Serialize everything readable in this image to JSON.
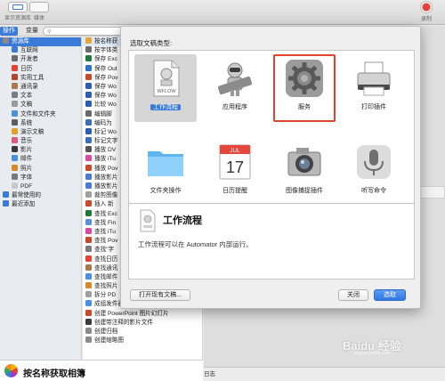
{
  "toolbar": {
    "library_label": "显示资源库",
    "media_label": "媒体",
    "record_label": "录制"
  },
  "library_bar": {
    "tab_actions": "操作",
    "tab_variables": "变量"
  },
  "library": {
    "items": [
      {
        "label": "资源库",
        "level": "root",
        "color": "#8a8a8a"
      },
      {
        "label": "互联网",
        "level": "lvl1",
        "color": "#3b7ad8"
      },
      {
        "label": "开发者",
        "level": "lvl1",
        "color": "#6c6c6c"
      },
      {
        "label": "日历",
        "level": "lvl1",
        "color": "#e94335"
      },
      {
        "label": "实用工具",
        "level": "lvl1",
        "color": "#b0472d"
      },
      {
        "label": "通讯录",
        "level": "lvl1",
        "color": "#a8794a"
      },
      {
        "label": "文本",
        "level": "lvl1",
        "color": "#7d7d7d"
      },
      {
        "label": "文稿",
        "level": "lvl1",
        "color": "#9a9a9a"
      },
      {
        "label": "文件和文件夹",
        "level": "lvl1",
        "color": "#4a90d9"
      },
      {
        "label": "系统",
        "level": "lvl1",
        "color": "#5d5d5d"
      },
      {
        "label": "演示文稿",
        "level": "lvl1",
        "color": "#e0a02a"
      },
      {
        "label": "音乐",
        "level": "lvl1",
        "color": "#e05a7a"
      },
      {
        "label": "影片",
        "level": "lvl1",
        "color": "#3a3a3a"
      },
      {
        "label": "邮件",
        "level": "lvl1",
        "color": "#4a8fe0"
      },
      {
        "label": "照片",
        "level": "lvl1",
        "color": "#d88a2a"
      },
      {
        "label": "字体",
        "level": "lvl1",
        "color": "#7a7a7a"
      },
      {
        "label": "PDF",
        "level": "lvl1",
        "color": "#c9c9c9"
      },
      {
        "label": "最常使用的",
        "level": "lvl0",
        "color": "#3a7ad8"
      },
      {
        "label": "最近添加",
        "level": "lvl0",
        "color": "#3a7ad8"
      }
    ]
  },
  "actions": {
    "items": [
      {
        "label": "按名称获",
        "color": "#e8a23a"
      },
      {
        "label": "按字体类",
        "color": "#6b6b6b"
      },
      {
        "label": "保存 Exc",
        "color": "#1e7a3c"
      },
      {
        "label": "保存 Out",
        "color": "#2f72c9"
      },
      {
        "label": "保存 Pov",
        "color": "#c94a2a"
      },
      {
        "label": "保存 Wo",
        "color": "#2f5db3"
      },
      {
        "label": "保存 Wo",
        "color": "#2f5db3"
      },
      {
        "label": "比较 Wo",
        "color": "#2f5db3"
      },
      {
        "label": "编辑脚",
        "color": "#6a6a6a"
      },
      {
        "label": "编码为",
        "color": "#3a6fb8"
      },
      {
        "label": "标记 Wo",
        "color": "#2f5db3"
      },
      {
        "label": "标记文字",
        "color": "#3a6fb8"
      },
      {
        "label": "播放 DV",
        "color": "#555555"
      },
      {
        "label": "播放 iTu",
        "color": "#d94aa0"
      },
      {
        "label": "播放 Pov",
        "color": "#c94a2a"
      },
      {
        "label": "播放影片",
        "color": "#4a7ad8"
      },
      {
        "label": "播放影片",
        "color": "#4a7ad8"
      },
      {
        "label": "裁剪图像",
        "color": "#a0a0a0"
      },
      {
        "label": "插入 新",
        "color": "#c94a2a"
      },
      {
        "label": "查找 Exc",
        "color": "#1e7a3c"
      },
      {
        "label": "查找 Fin",
        "color": "#5a8fd9"
      },
      {
        "label": "查找 iTu",
        "color": "#d94aa0"
      },
      {
        "label": "查找 Pov",
        "color": "#c94a2a"
      },
      {
        "label": "查找\"字",
        "color": "#7a7a7a"
      },
      {
        "label": "查找日历",
        "color": "#e94335"
      },
      {
        "label": "查找通讯",
        "color": "#a8794a"
      },
      {
        "label": "查找邮件",
        "color": "#4a8fe0"
      },
      {
        "label": "查找照片",
        "color": "#d88a2a"
      },
      {
        "label": "拆分 PD",
        "color": "#a0a0a0"
      },
      {
        "label": "成组发件器",
        "color": "#4a8fe0"
      },
      {
        "label": "创建 PowerPoint 图片幻灯片",
        "color": "#c94a2a"
      },
      {
        "label": "创建带注释的影片文件",
        "color": "#3a3a3a"
      },
      {
        "label": "创建归档",
        "color": "#8a8a8a"
      },
      {
        "label": "创建缩略图",
        "color": "#8a8a8a"
      }
    ]
  },
  "dialog": {
    "title": "选取文稿类型:",
    "types": [
      {
        "label": "工作流程",
        "icon": "workflow-icon"
      },
      {
        "label": "应用程序",
        "icon": "automator-robot-icon"
      },
      {
        "label": "服务",
        "icon": "gear-icon"
      },
      {
        "label": "打印插件",
        "icon": "printer-icon"
      },
      {
        "label": "文件夹操作",
        "icon": "folder-icon"
      },
      {
        "label": "日历提醒",
        "icon": "calendar-icon"
      },
      {
        "label": "图像捕捉插件",
        "icon": "camera-icon"
      },
      {
        "label": "听写命令",
        "icon": "microphone-icon"
      }
    ],
    "calendar_month": "JUL",
    "calendar_day": "17",
    "workflow_tag": "WFLOW",
    "info_title": "工作流程",
    "info_desc": "工作流程可以在 Automator 内部运行。",
    "open_existing_label": "打开现有文稿...",
    "close_label": "关闭",
    "choose_label": "选取"
  },
  "footer": {
    "description_title": "按名称获取相簿",
    "log_label": "日志"
  },
  "watermark": {
    "text": "Baidu 经验",
    "sub": "jingyan.baidu.com"
  },
  "colors": {
    "accent": "#3a7ad8",
    "highlight_border": "#e2432f"
  }
}
